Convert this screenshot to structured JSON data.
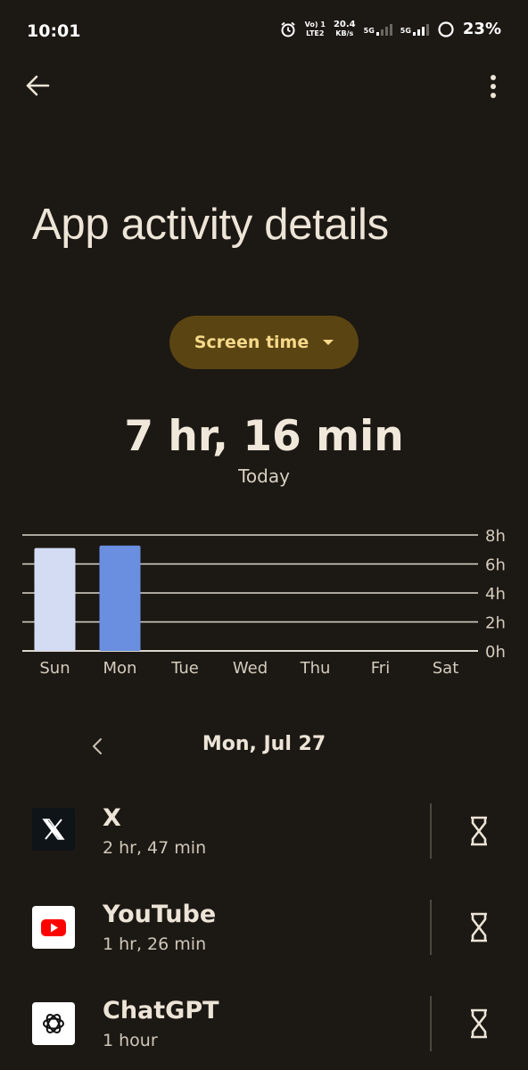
{
  "status_bar": {
    "time": "10:01",
    "volte": "Vo) 1",
    "lte": "LTE2",
    "speed_value": "20.4",
    "speed_unit": "KB/s",
    "net1": "5G",
    "net2": "5G",
    "battery": "23%"
  },
  "page_title": "App activity details",
  "dropdown": {
    "label": "Screen time"
  },
  "summary": {
    "total": "7 hr, 16 min",
    "period": "Today"
  },
  "chart_data": {
    "type": "bar",
    "categories": [
      "Sun",
      "Mon",
      "Tue",
      "Wed",
      "Thu",
      "Fri",
      "Sat"
    ],
    "values": [
      7.1,
      7.27,
      0,
      0,
      0,
      0,
      0
    ],
    "selected_index": 1,
    "y_ticks": [
      "0h",
      "2h",
      "4h",
      "6h",
      "8h"
    ],
    "ylim": [
      0,
      8
    ],
    "colors": {
      "bar": "#d4dcf4",
      "selected_bar": "#6a8ee0",
      "grid": "#dcd6cc",
      "text": "#d4ccbe"
    }
  },
  "date_nav": {
    "label": "Mon, Jul 27"
  },
  "apps": [
    {
      "name": "X",
      "time": "2 hr, 47 min",
      "icon": "x-logo-icon"
    },
    {
      "name": "YouTube",
      "time": "1 hr, 26 min",
      "icon": "youtube-icon"
    },
    {
      "name": "ChatGPT",
      "time": "1 hour",
      "icon": "chatgpt-icon"
    }
  ],
  "colors": {
    "background": "#1c1814",
    "accent_chip": "#5a4412",
    "accent_text": "#f6d98a"
  }
}
